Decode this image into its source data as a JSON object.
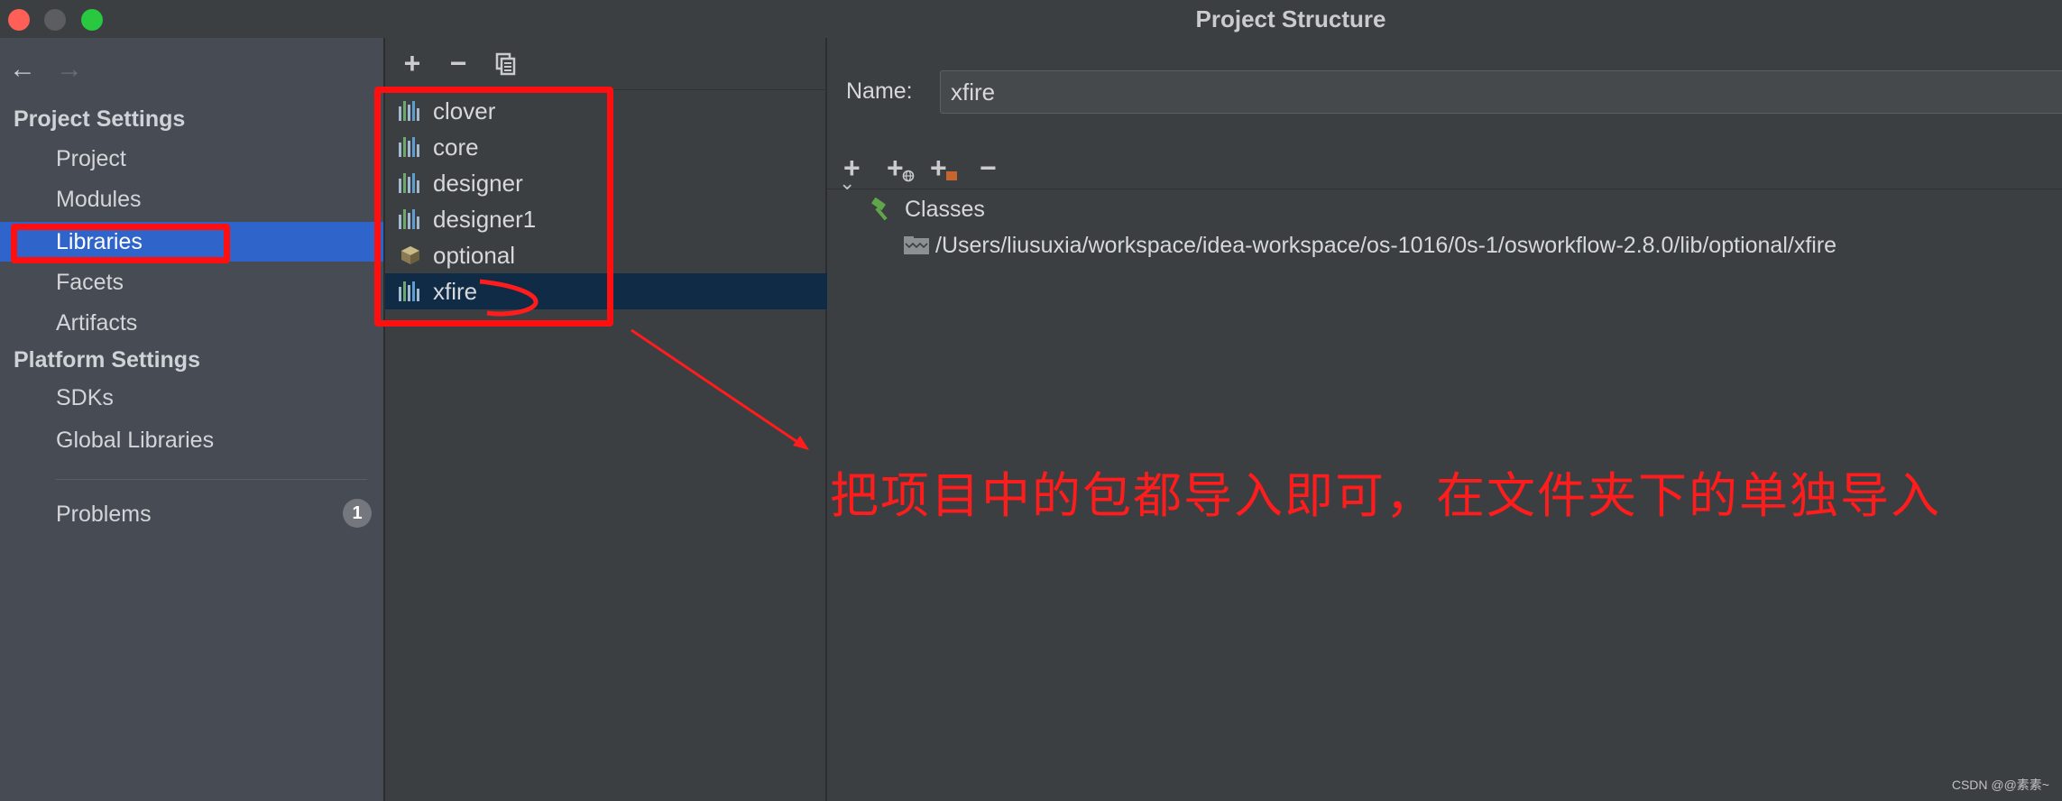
{
  "window": {
    "title": "Project Structure"
  },
  "sidebar": {
    "back_icon": "←",
    "forward_icon": "→",
    "sections": [
      {
        "header": "Project Settings",
        "items": [
          "Project",
          "Modules",
          "Libraries",
          "Facets",
          "Artifacts"
        ]
      },
      {
        "header": "Platform Settings",
        "items": [
          "SDKs",
          "Global Libraries"
        ]
      }
    ],
    "selected_item": "Libraries",
    "problems": {
      "label": "Problems",
      "count": "1"
    }
  },
  "libraries_toolbar": {
    "add": "+",
    "remove": "−",
    "copy_icon": "copy-icon"
  },
  "libraries": [
    {
      "name": "clover",
      "icon": "library-icon"
    },
    {
      "name": "core",
      "icon": "library-icon"
    },
    {
      "name": "designer",
      "icon": "library-icon"
    },
    {
      "name": "designer1",
      "icon": "library-icon"
    },
    {
      "name": "optional",
      "icon": "jar-icon"
    },
    {
      "name": "xfire",
      "icon": "library-icon"
    }
  ],
  "selected_library": "xfire",
  "details": {
    "name_label": "Name:",
    "name_value": "xfire",
    "toolbar": [
      "+",
      "+",
      "+",
      "−"
    ],
    "tree": {
      "root_label": "Classes",
      "children": [
        "/Users/liusuxia/workspace/idea-workspace/os-1016/0s-1/osworkflow-2.8.0/lib/optional/xfire"
      ]
    }
  },
  "annotation": {
    "text": "把项目中的包都导入即可，在文件夹下的单独导入",
    "color": "#ff1c1c"
  },
  "watermark": "CSDN @@素素~",
  "colors": {
    "selection": "#2f65ca",
    "list_selection": "#0f2b45",
    "annotation_red": "#ff0f0f"
  }
}
